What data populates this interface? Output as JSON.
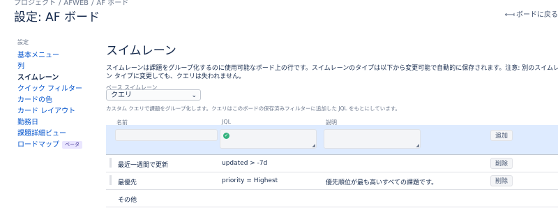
{
  "breadcrumb": {
    "project": "プロジェクト",
    "sep1": "/",
    "key": "AFWEB",
    "sep2": "/",
    "board": "AF ボード"
  },
  "page_title": "設定: AF ボード",
  "back_link": {
    "arrow": "⟻",
    "label": "ボードに戻る"
  },
  "sidebar": {
    "heading": "設定",
    "items": [
      {
        "label": "基本メニュー"
      },
      {
        "label": "列"
      },
      {
        "label": "スイムレーン"
      },
      {
        "label": "クイック フィルター"
      },
      {
        "label": "カードの色"
      },
      {
        "label": "カード レイアウト"
      },
      {
        "label": "勤務日"
      },
      {
        "label": "課題詳細ビュー"
      },
      {
        "label": "ロードマップ",
        "badge": "ベータ"
      }
    ],
    "active_index": 2
  },
  "main": {
    "title": "スイムレーン",
    "description": "スイムレーンは課題をグループ化するのに使用可能なボード上の行です。スイムレーンのタイプは以下から変更可能で自動的に保存されます。注意: 別のスイムレーン タイプに変更しても、クエリは失われません。"
  },
  "base_swimlane": {
    "label": "ベース スイムレーン",
    "selected": "クエリ",
    "helper": "カスタム クエリで課題をグループ化します。クエリはこのボードの保存済みフィルターに追加した JQL をもとにしています。"
  },
  "table": {
    "headers": {
      "name": "名前",
      "jql": "JQL",
      "description": "説明"
    },
    "add_button": "追加",
    "rows": [
      {
        "name": "最近一週間で更新",
        "jql": "updated > -7d",
        "description": "",
        "action": "削除"
      },
      {
        "name": "最優先",
        "jql": "priority = Highest",
        "description": "優先順位が最も高いすべての課題です。",
        "action": "削除"
      }
    ],
    "other": "その他"
  },
  "colors": {
    "link": "#0052cc",
    "add_row_bg": "#deebff",
    "valid": "#36b37e"
  }
}
